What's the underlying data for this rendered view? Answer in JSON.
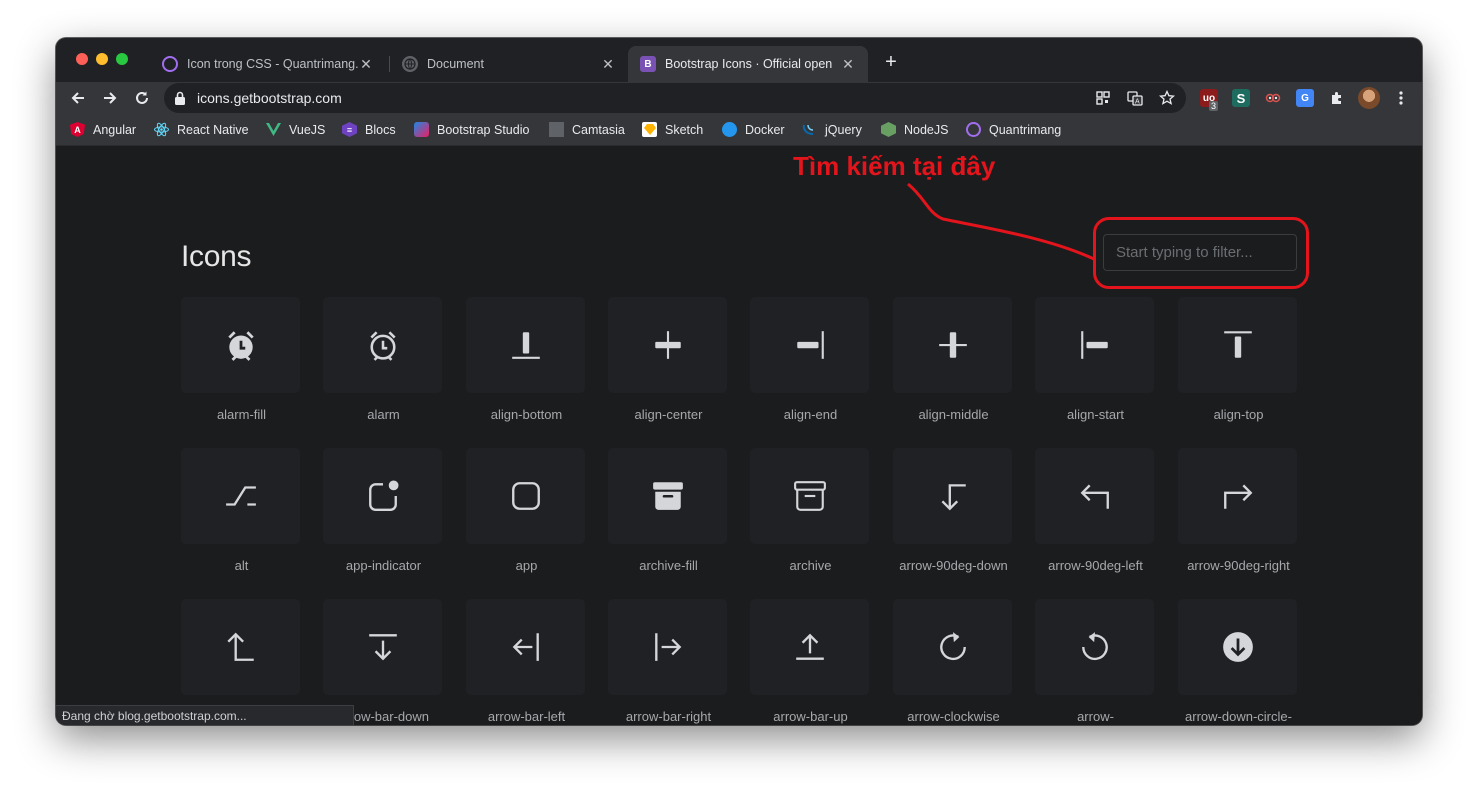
{
  "tabs": [
    {
      "title": "Icon trong CSS - Quantrimang.",
      "favicon": "quantrimang-icon",
      "active": false
    },
    {
      "title": "Document",
      "favicon": "globe-icon",
      "active": false
    },
    {
      "title": "Bootstrap Icons · Official open",
      "favicon": "bootstrap-icon",
      "favicon_text": "B",
      "active": true
    }
  ],
  "new_tab_symbol": "+",
  "address_bar": {
    "url": "icons.getbootstrap.com"
  },
  "extension_badge": "3",
  "bookmarks": [
    {
      "label": "Angular",
      "icon": "angular-icon",
      "color": "#dd0031"
    },
    {
      "label": "React Native",
      "icon": "react-icon",
      "color": "#61dafb"
    },
    {
      "label": "VueJS",
      "icon": "vue-icon",
      "color": "#41b883"
    },
    {
      "label": "Blocs",
      "icon": "blocs-icon",
      "color": "#6f42c1"
    },
    {
      "label": "Bootstrap Studio",
      "icon": "bootstrap-studio-icon",
      "color": "#1e88e5"
    },
    {
      "label": "Camtasia",
      "icon": "camtasia-icon",
      "color": "#7a7a7a"
    },
    {
      "label": "Sketch",
      "icon": "sketch-icon",
      "color": "#fdb300"
    },
    {
      "label": "Docker",
      "icon": "docker-icon",
      "color": "#2496ed"
    },
    {
      "label": "jQuery",
      "icon": "jquery-icon",
      "color": "#0769ad"
    },
    {
      "label": "NodeJS",
      "icon": "nodejs-icon",
      "color": "#68a063"
    },
    {
      "label": "Quantrimang",
      "icon": "quantrimang-icon",
      "color": "#a26ef0"
    }
  ],
  "page": {
    "title": "Icons",
    "search_placeholder": "Start typing to filter...",
    "annotation": "Tìm kiếm tại đây"
  },
  "icons": [
    {
      "name": "alarm-fill"
    },
    {
      "name": "alarm"
    },
    {
      "name": "align-bottom"
    },
    {
      "name": "align-center"
    },
    {
      "name": "align-end"
    },
    {
      "name": "align-middle"
    },
    {
      "name": "align-start"
    },
    {
      "name": "align-top"
    },
    {
      "name": "alt"
    },
    {
      "name": "app-indicator"
    },
    {
      "name": "app"
    },
    {
      "name": "archive-fill"
    },
    {
      "name": "archive"
    },
    {
      "name": "arrow-90deg-down"
    },
    {
      "name": "arrow-90deg-left"
    },
    {
      "name": "arrow-90deg-right"
    },
    {
      "name": "arrow-90deg-up"
    },
    {
      "name": "arrow-bar-down"
    },
    {
      "name": "arrow-bar-left"
    },
    {
      "name": "arrow-bar-right"
    },
    {
      "name": "arrow-bar-up"
    },
    {
      "name": "arrow-clockwise"
    },
    {
      "name": "arrow-"
    },
    {
      "name": "arrow-down-circle-"
    }
  ],
  "status_text": "Đang chờ blog.getbootstrap.com...",
  "colors": {
    "annotation": "#e3141b",
    "accent": "#7952b3",
    "page_bg": "#1b1c1e",
    "tile_bg": "#202124"
  }
}
